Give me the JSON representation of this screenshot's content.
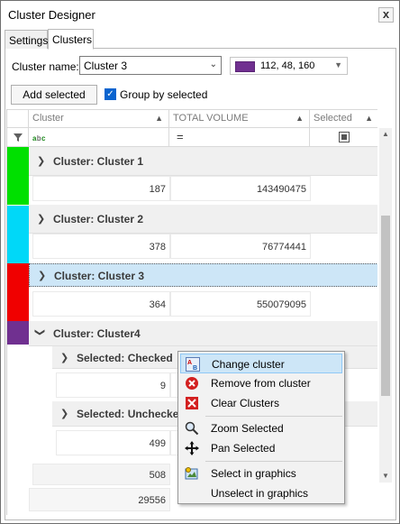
{
  "window": {
    "title": "Cluster Designer",
    "close_glyph": "x"
  },
  "tabs": [
    {
      "label": "Settings"
    },
    {
      "label": "Clusters"
    }
  ],
  "cluster_name": {
    "label": "Cluster name:",
    "value": "Cluster 3"
  },
  "color_picker": {
    "value": "112, 48, 160",
    "swatch": "#703090"
  },
  "add_selected": {
    "label": "Add selected"
  },
  "group_by": {
    "label": "Group by selected",
    "checked": true
  },
  "grid": {
    "columns": [
      {
        "label": "Cluster"
      },
      {
        "label": "TOTAL VOLUME"
      },
      {
        "label": "Selected"
      }
    ],
    "filter_text_icon": "a-b-c-text-filter-icon",
    "filter_equals": "=",
    "groups": [
      {
        "label": "Cluster: Cluster 1",
        "color": "#00e000",
        "count": "187",
        "volume": "143490475"
      },
      {
        "label": "Cluster: Cluster 2",
        "color": "#00d8f8",
        "count": "378",
        "volume": "76774441"
      },
      {
        "label": "Cluster: Cluster 3",
        "color": "#f00000",
        "count": "364",
        "volume": "550079095",
        "selected": true
      },
      {
        "label": "Cluster: Cluster4",
        "color": "#703090",
        "expanded": true,
        "subgroups": [
          {
            "label": "Selected: Checked",
            "count": "9"
          },
          {
            "label": "Selected: Unchecked",
            "count": "499"
          }
        ],
        "count": "508"
      }
    ],
    "footer": {
      "count": "29556"
    }
  },
  "context_menu": {
    "items": [
      {
        "label": "Change cluster",
        "icon": "change-cluster-icon",
        "highlighted": true
      },
      {
        "label": "Remove from cluster",
        "icon": "remove-icon"
      },
      {
        "label": "Clear Clusters",
        "icon": "clear-icon"
      },
      {
        "label": "Zoom Selected",
        "icon": "zoom-icon"
      },
      {
        "label": "Pan Selected",
        "icon": "pan-icon"
      },
      {
        "label": "Select in graphics",
        "icon": "select-graphics-icon"
      },
      {
        "label": "Unselect in graphics",
        "icon": "unselect-graphics-icon"
      }
    ]
  }
}
